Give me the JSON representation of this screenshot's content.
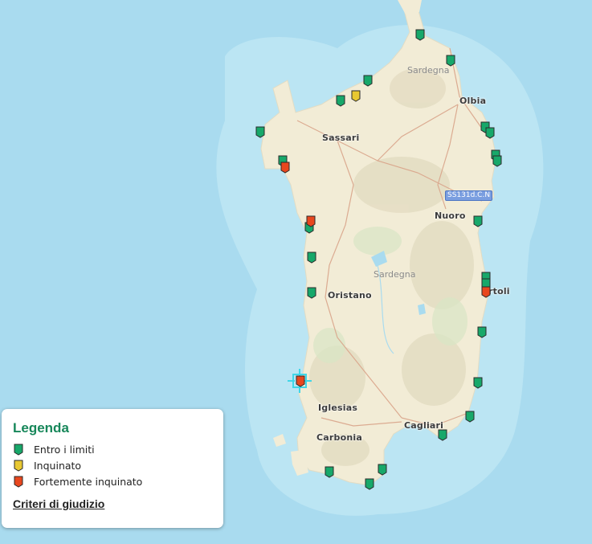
{
  "map": {
    "cities": [
      {
        "name": "Sardegna",
        "kind": "region"
      },
      {
        "name": "Olbia",
        "kind": "city"
      },
      {
        "name": "Sassari",
        "kind": "city"
      },
      {
        "name": "Nuoro",
        "kind": "city"
      },
      {
        "name": "Sardegna",
        "kind": "region"
      },
      {
        "name": "Oristano",
        "kind": "city"
      },
      {
        "name": "rtoli",
        "kind": "city"
      },
      {
        "name": "Iglesias",
        "kind": "city"
      },
      {
        "name": "Cagliari",
        "kind": "city"
      },
      {
        "name": "Carbonia",
        "kind": "city"
      }
    ],
    "road_shield": "SS131d.C.N",
    "colors": {
      "sea": "#a9dbef",
      "land": "#f2ecd6",
      "status_ok": "#17a86a",
      "status_polluted": "#e8c832",
      "status_heavily_polluted": "#e8471e",
      "selection": "#3fd6e8"
    },
    "markers": [
      {
        "status": "ok"
      },
      {
        "status": "ok"
      },
      {
        "status": "ok"
      },
      {
        "status": "polluted"
      },
      {
        "status": "ok"
      },
      {
        "status": "ok"
      },
      {
        "status": "ok"
      },
      {
        "status": "ok"
      },
      {
        "status": "ok"
      },
      {
        "status": "ok"
      },
      {
        "status": "ok"
      },
      {
        "status": "heavily_polluted"
      },
      {
        "status": "ok"
      },
      {
        "status": "heavily_polluted"
      },
      {
        "status": "ok"
      },
      {
        "status": "ok"
      },
      {
        "status": "ok"
      },
      {
        "status": "ok"
      },
      {
        "status": "heavily_polluted"
      },
      {
        "status": "ok"
      },
      {
        "status": "heavily_polluted",
        "selected": true
      },
      {
        "status": "ok"
      },
      {
        "status": "ok"
      },
      {
        "status": "ok"
      },
      {
        "status": "ok"
      },
      {
        "status": "ok"
      },
      {
        "status": "ok"
      },
      {
        "status": "ok"
      }
    ]
  },
  "legend": {
    "title": "Legenda",
    "items": [
      {
        "label": "Entro i limiti",
        "color": "#17a86a",
        "icon": "marker-green-icon"
      },
      {
        "label": "Inquinato",
        "color": "#e8c832",
        "icon": "marker-yellow-icon"
      },
      {
        "label": "Fortemente inquinato",
        "color": "#e8471e",
        "icon": "marker-red-icon"
      }
    ],
    "link_label": "Criteri di giudizio"
  }
}
